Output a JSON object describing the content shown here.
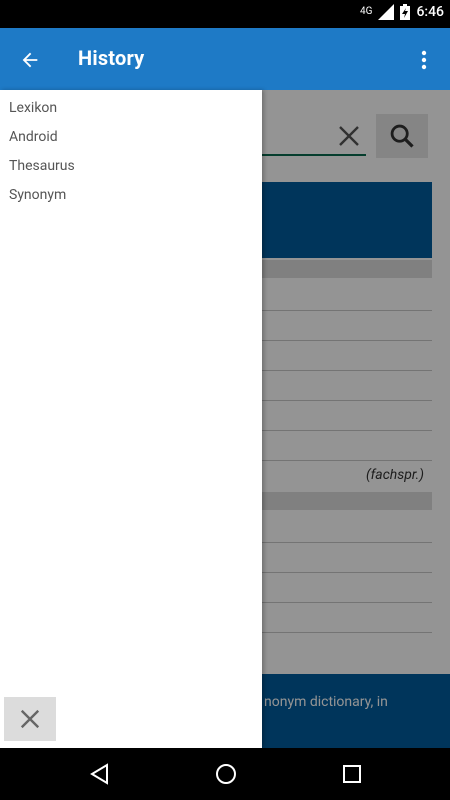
{
  "status_bar": {
    "network": "4G",
    "time": "6:46"
  },
  "app_bar": {
    "title": "History"
  },
  "drawer": {
    "items": [
      "Lexikon",
      "Android",
      "Thesaurus",
      "Synonym"
    ]
  },
  "background": {
    "italic_note": "(fachspr.)",
    "banner_text": "nonym dictionary, in"
  },
  "colors": {
    "app_bar": "#1e7ac6",
    "tab_blue": "#005c9e",
    "scrim": "rgba(0,0,0,0.42)"
  }
}
